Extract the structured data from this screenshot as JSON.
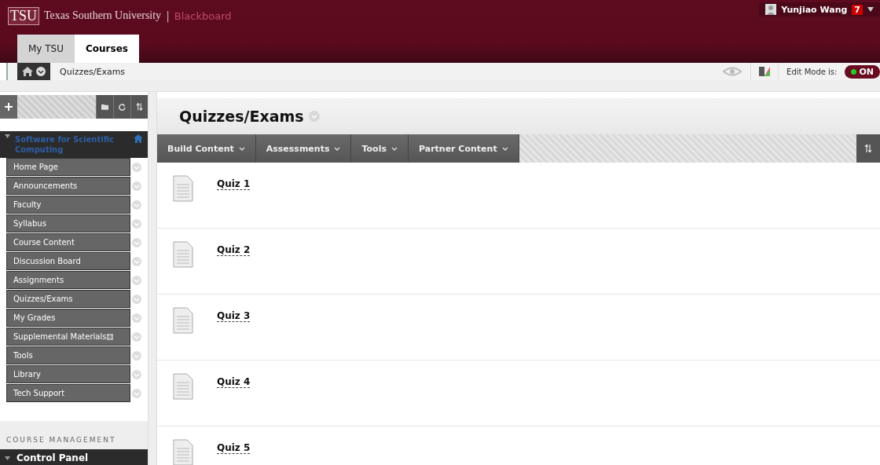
{
  "header": {
    "logo": "TSU",
    "title": "Texas Southern University",
    "divider": "|",
    "brand": "Blackboard",
    "user": "Yunjiao Wang",
    "notifications": "7"
  },
  "tabs": [
    {
      "label": "My TSU",
      "selected": false
    },
    {
      "label": "Courses",
      "selected": true
    }
  ],
  "breadcrumb": "Quizzes/Exams",
  "edit_mode": {
    "label": "Edit Mode is:",
    "value": "ON",
    "on": true
  },
  "sidebar": {
    "course": "Software for Scientific Computing",
    "items": [
      {
        "label": "Home Page",
        "new_content": false
      },
      {
        "label": "Announcements",
        "new_content": false
      },
      {
        "label": "Faculty",
        "new_content": false
      },
      {
        "label": "Syllabus",
        "new_content": false
      },
      {
        "label": "Course Content",
        "new_content": false
      },
      {
        "label": "Discussion Board",
        "new_content": false
      },
      {
        "label": "Assignments",
        "new_content": false
      },
      {
        "label": "Quizzes/Exams",
        "new_content": false
      },
      {
        "label": "My Grades",
        "new_content": false
      },
      {
        "label": "Supplemental Materials",
        "new_content": true
      },
      {
        "label": "Tools",
        "new_content": false
      },
      {
        "label": "Library",
        "new_content": false
      },
      {
        "label": "Tech Support",
        "new_content": false
      }
    ],
    "section_label": "COURSE MANAGEMENT",
    "control_panel": "Control Panel"
  },
  "page_title": "Quizzes/Exams",
  "action_bar": [
    "Build Content",
    "Assessments",
    "Tools",
    "Partner Content"
  ],
  "items": [
    {
      "title": "Quiz 1"
    },
    {
      "title": "Quiz 2"
    },
    {
      "title": "Quiz 3"
    },
    {
      "title": "Quiz 4"
    },
    {
      "title": "Quiz 5"
    }
  ]
}
